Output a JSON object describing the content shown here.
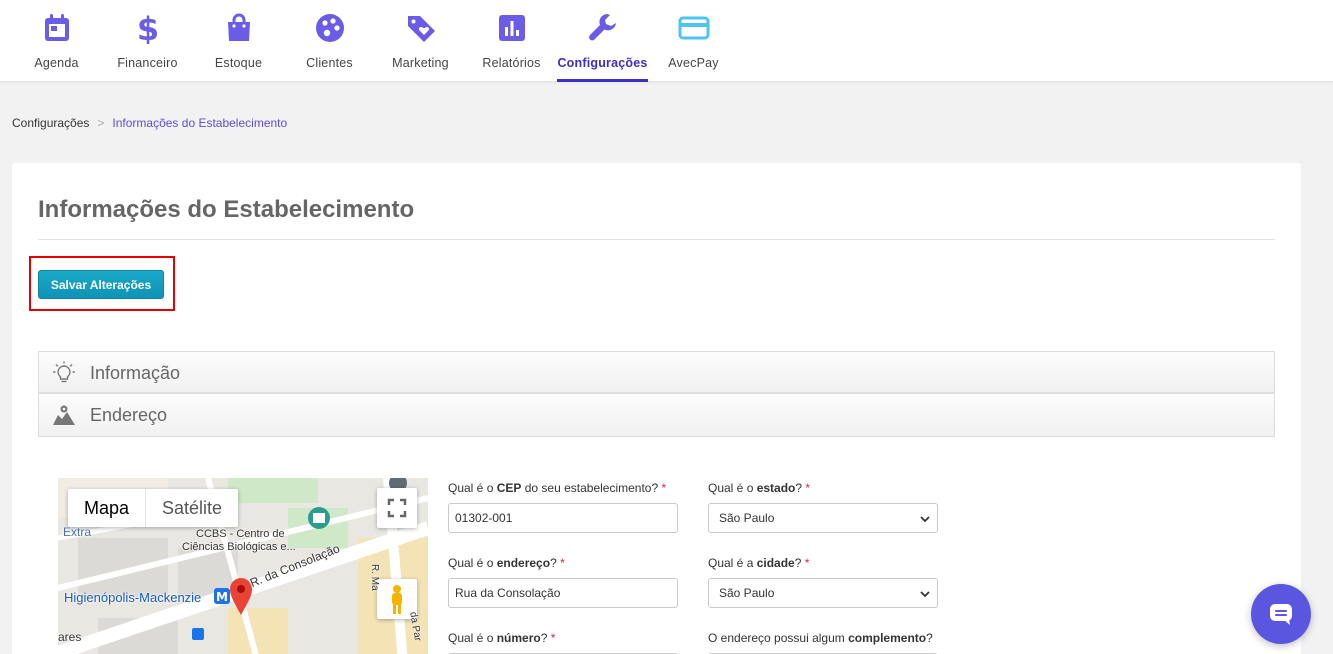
{
  "nav": {
    "items": [
      {
        "label": "Agenda",
        "icon": "calendar-icon"
      },
      {
        "label": "Financeiro",
        "icon": "dollar-icon"
      },
      {
        "label": "Estoque",
        "icon": "shopping-bag-icon"
      },
      {
        "label": "Clientes",
        "icon": "palette-icon"
      },
      {
        "label": "Marketing",
        "icon": "tag-heart-icon"
      },
      {
        "label": "Relatórios",
        "icon": "bar-chart-icon"
      },
      {
        "label": "Configurações",
        "icon": "wrench-icon"
      },
      {
        "label": "AvecPay",
        "icon": "credit-card-icon"
      }
    ],
    "active": "Configurações",
    "colors": {
      "icon": "#6b5ce7",
      "active": "#3d2fbf",
      "avecpay": "#4cc3f0"
    }
  },
  "breadcrumb": {
    "root": "Configurações",
    "separator": ">",
    "current": "Informações do Estabelecimento"
  },
  "page": {
    "title": "Informações do Estabelecimento",
    "save_label": "Salvar Alterações"
  },
  "sections": {
    "info": "Informação",
    "address": "Endereço"
  },
  "map": {
    "types": {
      "map": "Mapa",
      "satellite": "Satélite"
    },
    "labels": {
      "extra": "Extra",
      "ccbs_line1": "CCBS - Centro de",
      "ccbs_line2": "Ciências Biológicas e...",
      "street": "R. da Consolação",
      "station": "Higienópolis-Mackenzie",
      "bares": "ares",
      "street_vertical": "R. Ma",
      "street_vertical2": "da Par"
    }
  },
  "form": {
    "cep": {
      "label_pre": "Qual é o ",
      "label_bold": "CEP",
      "label_post": " do seu estabelecimento?",
      "value": "01302-001"
    },
    "estado": {
      "label_pre": "Qual é o ",
      "label_bold": "estado",
      "label_post": "?",
      "value": "São Paulo"
    },
    "endereco": {
      "label_pre": "Qual é o ",
      "label_bold": "endereço",
      "label_post": "?",
      "value": "Rua da Consolação"
    },
    "cidade": {
      "label_pre": "Qual é a ",
      "label_bold": "cidade",
      "label_post": "?",
      "value": "São Paulo"
    },
    "numero": {
      "label_pre": "Qual é o ",
      "label_bold": "número",
      "label_post": "?"
    },
    "complemento": {
      "label_pre": "O endereço possui algum ",
      "label_bold": "complemento",
      "label_post": "?"
    },
    "required_mark": "*"
  }
}
